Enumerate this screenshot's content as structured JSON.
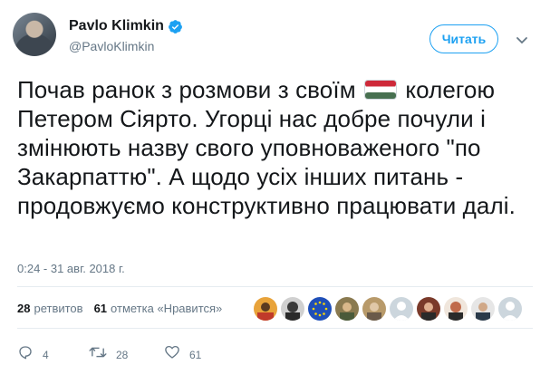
{
  "author": {
    "name": "Pavlo Klimkin",
    "handle": "@PavloKlimkin",
    "verified": true,
    "avatar_icon": "user-avatar"
  },
  "follow_button": {
    "label": "Читать",
    "color": "#1da1f2"
  },
  "menu": {
    "icon": "chevron-down-icon"
  },
  "tweet": {
    "text_before_flag": "Почав ранок з розмови з своїм ",
    "flag_icon": "hungary-flag-icon",
    "flag_colors": [
      "#ce2939",
      "#ffffff",
      "#477050"
    ],
    "text_after_flag": " колегою Петером Сіярто.  Угорці нас добре почули і змінюють назву свого уповноваженого \"по Закарпаттю\". А щодо усіх інших питань - продовжуємо конструктивно працювати далі."
  },
  "timestamp": "0:24 - 31 авг. 2018 г.",
  "stats": {
    "retweets_count": "28",
    "retweets_label": "ретвитов",
    "likes_count": "61",
    "likes_label": "отметка «Нравится»"
  },
  "likers": [
    {
      "icon": "liker-avatar-icon",
      "color": "#e8a33a"
    },
    {
      "icon": "liker-avatar-icon",
      "color": "#4a4a4a"
    },
    {
      "icon": "eu-flag-icon",
      "color": "#1f4fb8"
    },
    {
      "icon": "liker-avatar-icon",
      "color": "#8a7a50"
    },
    {
      "icon": "liker-avatar-icon",
      "color": "#b89a6a"
    },
    {
      "icon": "default-avatar-icon",
      "color": "#ccd6dd"
    },
    {
      "icon": "liker-avatar-icon",
      "color": "#7a3a2a"
    },
    {
      "icon": "liker-avatar-icon",
      "color": "#c06a4a"
    },
    {
      "icon": "liker-avatar-icon",
      "color": "#2a3a4a"
    },
    {
      "icon": "default-avatar-icon",
      "color": "#ccd6dd"
    }
  ],
  "actions": {
    "reply_icon": "reply-icon",
    "reply_count": "4",
    "retweet_icon": "retweet-icon",
    "retweet_count": "28",
    "like_icon": "heart-icon",
    "like_count": "61"
  },
  "colors": {
    "text": "#14171a",
    "muted": "#657786",
    "divider": "#e6ecf0",
    "accent": "#1da1f2"
  }
}
